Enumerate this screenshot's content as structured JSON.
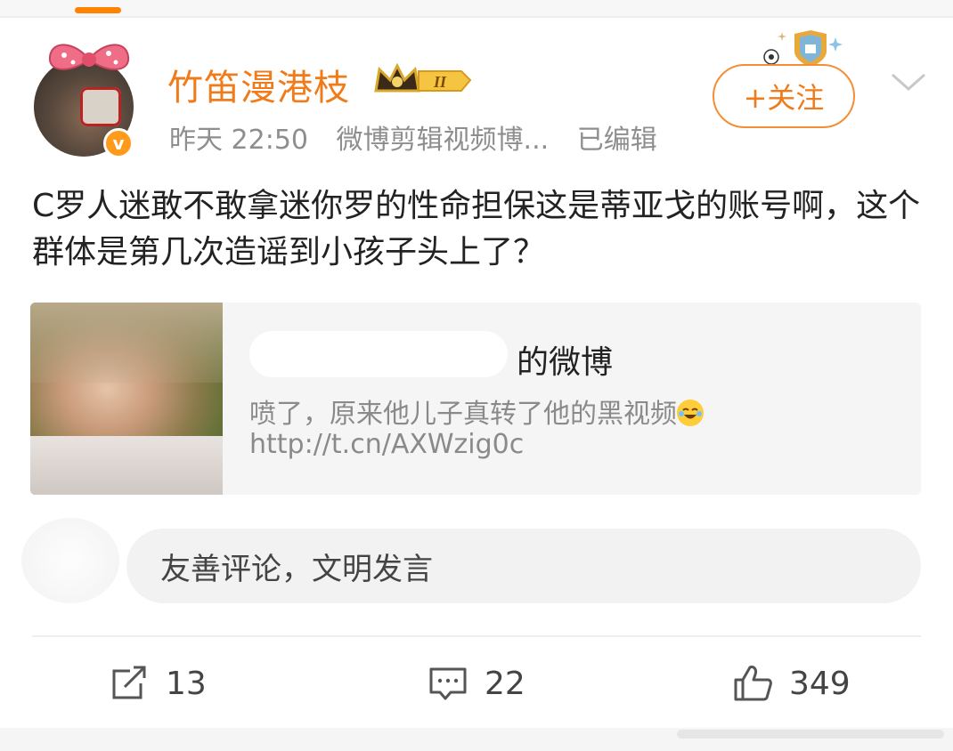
{
  "colors": {
    "accent": "#ff8200",
    "username": "#f07b1a",
    "meta_gray": "#8e8e8e"
  },
  "post": {
    "author": {
      "name": "竹笛漫港枝",
      "level_badge": "II",
      "verified_mark": "v"
    },
    "meta": {
      "time": "昨天 22:50",
      "source": "微博剪辑视频博...",
      "edited": "已编辑"
    },
    "follow_label": "+关注",
    "text": "C罗人迷敢不敢拿迷你罗的性命担保这是蒂亚戈的账号啊，这个群体是第几次造谣到小孩子头上了？"
  },
  "quote": {
    "author_suffix": "的微博",
    "body": "喷了，原来他儿子真转了他的黑视频",
    "link": "http://t.cn/AXWzig0c"
  },
  "comment": {
    "placeholder": "友善评论，文明发言"
  },
  "actions": {
    "repost_count": "13",
    "comment_count": "22",
    "like_count": "349"
  }
}
